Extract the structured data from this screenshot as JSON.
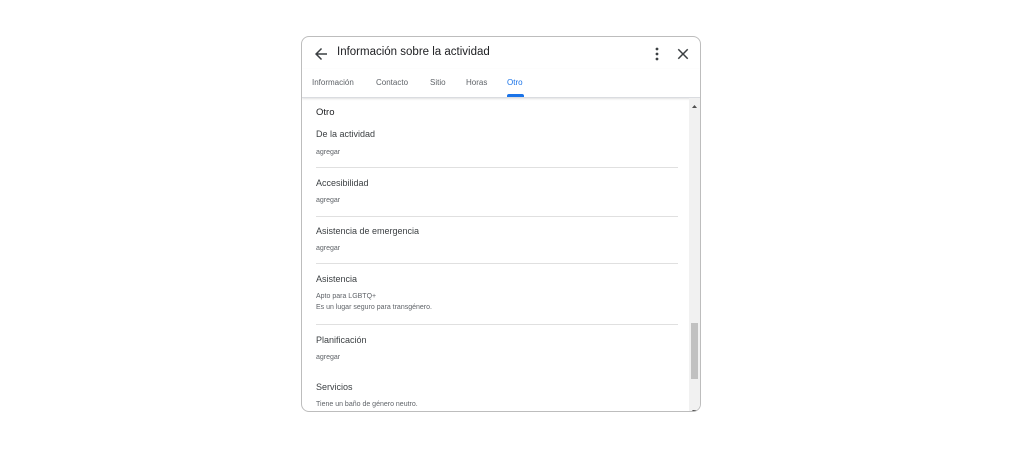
{
  "dialog": {
    "title": "Información sobre la actividad",
    "icons": {
      "back": "arrow-left-icon",
      "more": "more-vert-icon",
      "close": "close-icon"
    }
  },
  "tabs": [
    {
      "label": "Información",
      "active": false
    },
    {
      "label": "Contacto",
      "active": false
    },
    {
      "label": "Sitio",
      "active": false
    },
    {
      "label": "Horas",
      "active": false
    },
    {
      "label": "Otro",
      "active": true
    }
  ],
  "colors": {
    "accent": "#1a73e8",
    "divider": "#e0e0e0",
    "muted": "#5f6368"
  },
  "content": {
    "section_title": "Otro",
    "items": [
      {
        "label": "De la actividad",
        "values": [
          "agregar"
        ]
      },
      {
        "label": "Accesibilidad",
        "values": [
          "agregar"
        ]
      },
      {
        "label": "Asistencia de emergencia",
        "values": [
          "agregar"
        ]
      },
      {
        "label": "Asistencia",
        "values": [
          "Apto para LGBTQ+",
          "Es un lugar seguro para transgénero."
        ]
      },
      {
        "label": "Planificación",
        "values": [
          "agregar"
        ]
      },
      {
        "label": "Servicios",
        "values": [
          "Tiene un baño de género neutro."
        ]
      }
    ]
  }
}
